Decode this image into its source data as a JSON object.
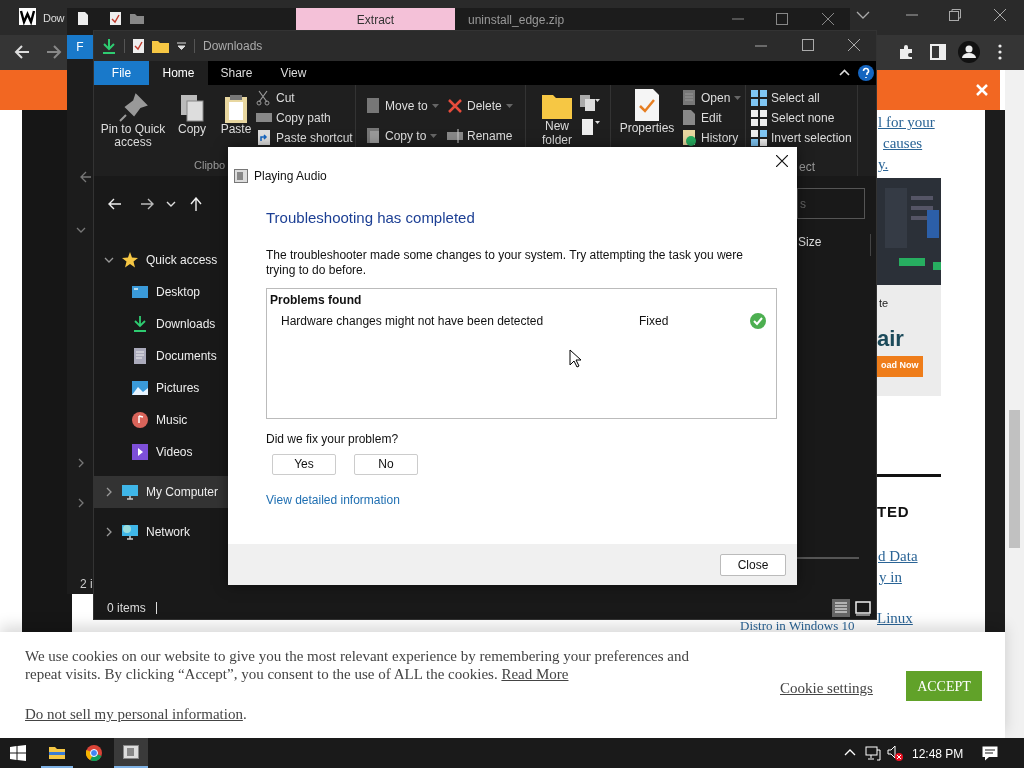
{
  "browser": {
    "tab_title": "Dow",
    "article_lines": [
      "l for your",
      "causes",
      "y."
    ],
    "ad": {
      "caption": "te",
      "brand": "air",
      "button": "oad Now"
    },
    "section_heading": "TED",
    "related_links": [
      "d Data",
      "y in",
      "Linux"
    ],
    "bottom_link": "Distro in Windows 10"
  },
  "zip_window": {
    "extract_tab": "Extract",
    "title": "uninstall_edge.zip",
    "file_tab": "F",
    "status": "2 i"
  },
  "explorer": {
    "title": "Downloads",
    "ribbon_tabs": [
      {
        "label": "File",
        "kind": "file",
        "selected": false
      },
      {
        "label": "Home",
        "kind": "tab",
        "selected": true
      },
      {
        "label": "Share",
        "kind": "tab",
        "selected": false
      },
      {
        "label": "View",
        "kind": "tab",
        "selected": false
      }
    ],
    "clipboard": {
      "large": [
        {
          "label": "Pin to Quick access",
          "kind": "pin"
        },
        {
          "label": "Copy",
          "kind": "copy"
        },
        {
          "label": "Paste",
          "kind": "paste"
        }
      ],
      "small": [
        {
          "label": "Cut",
          "kind": "cut"
        },
        {
          "label": "Copy path",
          "kind": "path"
        },
        {
          "label": "Paste shortcut",
          "kind": "shortcut"
        }
      ],
      "group_label": "Clipbo"
    },
    "organize": [
      {
        "label": "Move to",
        "kind": "move"
      },
      {
        "label": "Copy to",
        "kind": "copyto"
      },
      {
        "label": "Delete",
        "kind": "delete"
      },
      {
        "label": "Rename",
        "kind": "rename"
      }
    ],
    "new_folder": "New folder",
    "properties": "Properties",
    "open_items": [
      {
        "label": "Open",
        "kind": "open"
      },
      {
        "label": "Edit",
        "kind": "edit"
      },
      {
        "label": "History",
        "kind": "history"
      }
    ],
    "select_items": [
      "Select all",
      "Select none",
      "Invert selection"
    ],
    "select_group_label": "ect",
    "search_placeholder": "s",
    "column": "Size",
    "nav": [
      {
        "label": "Quick access",
        "kind": "star",
        "expanded": true,
        "selected": false,
        "children": [
          {
            "label": "Desktop",
            "kind": "desktop",
            "selected": false
          },
          {
            "label": "Downloads",
            "kind": "download",
            "selected": false
          },
          {
            "label": "Documents",
            "kind": "document",
            "selected": false
          },
          {
            "label": "Pictures",
            "kind": "pictures",
            "selected": false
          },
          {
            "label": "Music",
            "kind": "music",
            "selected": false
          },
          {
            "label": "Videos",
            "kind": "videos",
            "selected": false
          }
        ]
      },
      {
        "label": "My Computer",
        "kind": "computer",
        "expanded": false,
        "selected": true
      },
      {
        "label": "Network",
        "kind": "network",
        "expanded": false,
        "selected": false
      }
    ],
    "status": "0 items"
  },
  "dialog": {
    "title": "Playing Audio",
    "heading": "Troubleshooting has completed",
    "message": "The troubleshooter made some changes to your system. Try attempting the task you were trying to do before.",
    "problems_header": "Problems found",
    "problems": [
      {
        "text": "Hardware changes might not have been detected",
        "status": "Fixed",
        "fixed": true
      }
    ],
    "question": "Did we fix your problem?",
    "answers": [
      "Yes",
      "No"
    ],
    "details_link": "View detailed information",
    "close_button": "Close"
  },
  "cookie_bar": {
    "message": "We use cookies on our website to give you the most relevant experience by remembering your preferences and repeat visits. By clicking “Accept”, you consent to the use of ALL the cookies.",
    "read_more": "Read More",
    "opt_out_link": "Do not sell my personal information",
    "opt_out_suffix": ".",
    "settings_link": "Cookie settings",
    "accept_button": "ACCEPT"
  },
  "taskbar": {
    "time": "12:48 PM"
  }
}
